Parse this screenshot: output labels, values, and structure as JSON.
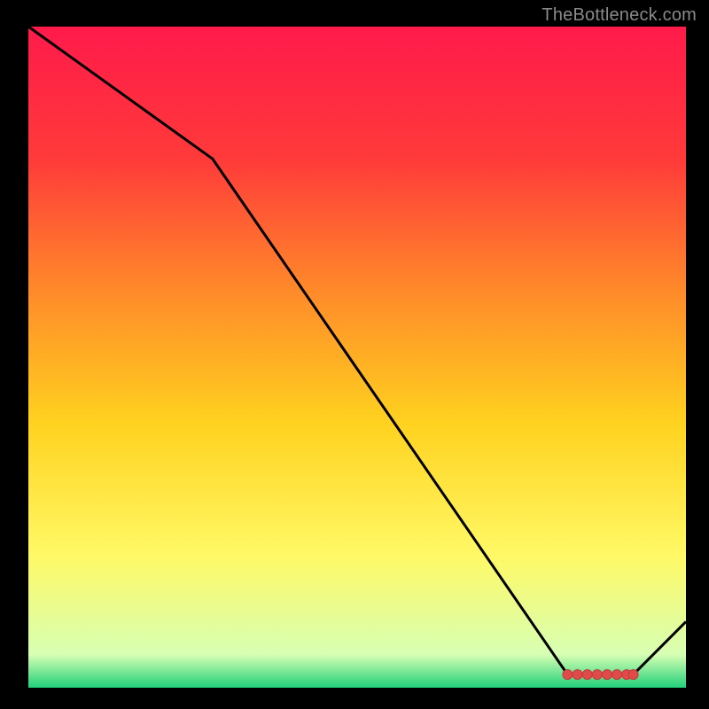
{
  "watermark": "TheBottleneck.com",
  "chart_data": {
    "type": "line",
    "title": "",
    "xlabel": "",
    "ylabel": "",
    "xlim": [
      0,
      100
    ],
    "ylim": [
      0,
      100
    ],
    "x": [
      0,
      28,
      82,
      92,
      100
    ],
    "values": [
      100,
      80,
      2,
      2,
      10
    ],
    "flat_segment_x": [
      82,
      92
    ],
    "marker_xs": [
      82,
      83.5,
      85,
      86.5,
      88,
      89.5,
      91,
      92
    ],
    "background_gradient_stops": [
      {
        "offset": 0.0,
        "color": "#ff1a4b"
      },
      {
        "offset": 0.2,
        "color": "#ff3a3a"
      },
      {
        "offset": 0.4,
        "color": "#ff8a2a"
      },
      {
        "offset": 0.6,
        "color": "#ffd21f"
      },
      {
        "offset": 0.8,
        "color": "#fff966"
      },
      {
        "offset": 0.95,
        "color": "#d7ffb3"
      },
      {
        "offset": 1.0,
        "color": "#21d07a"
      }
    ],
    "colors": {
      "line": "#000000",
      "marker_fill": "#e04a4a",
      "marker_stroke": "#c43a3a",
      "frame": "#000000"
    }
  }
}
